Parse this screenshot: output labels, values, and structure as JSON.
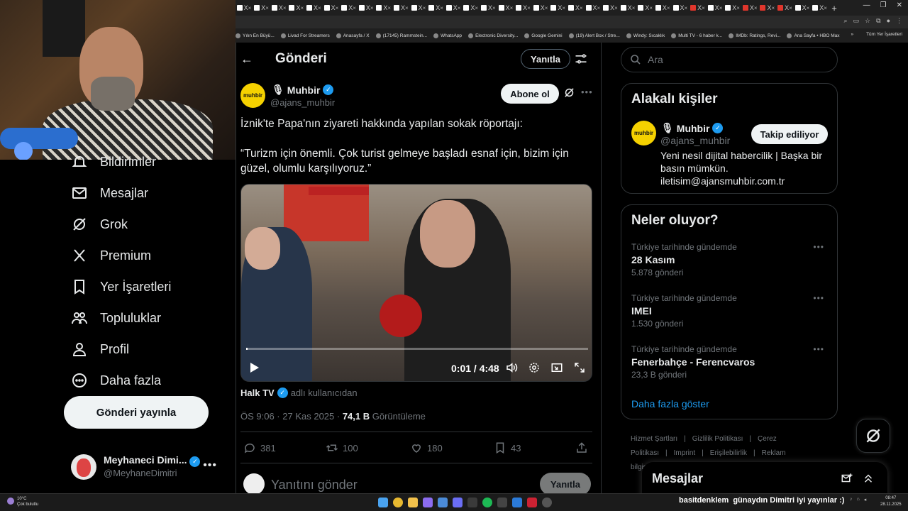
{
  "browser": {
    "tab_labels": [
      "X",
      "X",
      "X",
      "X",
      "X",
      "X",
      "X",
      "X",
      "X",
      "X",
      "X",
      "X",
      "X",
      "X",
      "X",
      "X",
      "X",
      "X",
      "X",
      "X",
      "X",
      "X",
      "X",
      "X",
      "X",
      "X",
      "X",
      "X",
      "X",
      "X",
      "X",
      "X",
      "X",
      "X"
    ],
    "tab_close": "×",
    "new_tab": "+",
    "bookmarks": [
      "Yılın En Büyü...",
      "Livad For Streamers",
      "Anasayfa / X",
      "(17145) Rammstein...",
      "WhatsApp",
      "Electronic Diversity...",
      "Google Gemini",
      "(19) Alert Box / Stre...",
      "Windy: Sıcaklık",
      "Multi TV - 6 haber k...",
      "IMDb: Ratings, Revi...",
      "Ana Sayfa • HBO Max"
    ],
    "bookmarks_more": "»",
    "all_bookmarks": "Tüm Yer İşaretleri"
  },
  "nav": {
    "items": [
      {
        "label": "Bildirimler",
        "icon": "bell-icon"
      },
      {
        "label": "Mesajlar",
        "icon": "envelope-icon"
      },
      {
        "label": "Grok",
        "icon": "grok-icon"
      },
      {
        "label": "Premium",
        "icon": "x-logo-icon"
      },
      {
        "label": "Yer İşaretleri",
        "icon": "bookmark-icon"
      },
      {
        "label": "Topluluklar",
        "icon": "people-icon"
      },
      {
        "label": "Profil",
        "icon": "person-icon"
      },
      {
        "label": "Daha fazla",
        "icon": "more-circle-icon"
      }
    ],
    "post_button": "Gönderi yayınla",
    "account": {
      "name": "Meyhaneci Dimi...",
      "handle": "@MeyhaneDimitri",
      "more": "•••"
    }
  },
  "header": {
    "back": "←",
    "title": "Gönderi",
    "reply_button": "Yanıtla"
  },
  "tweet": {
    "author_name": "Muhbir",
    "author_handle": "@ajans_muhbir",
    "avatar_text": "muhbir",
    "subscribe_button": "Abone ol",
    "more": "•••",
    "text_line1": "İznik'te Papa'nın ziyareti hakkında yapılan sokak röportajı:",
    "text_line2": "“Turizm için önemli. Çok turist gelmeye başladı esnaf için, bizim için güzel, olumlu karşılıyoruz.”",
    "video": {
      "time": "0:01 / 4:48",
      "progress": 0.004
    },
    "source_name": "Halk TV",
    "source_suffix": "adlı kullanıcıdan",
    "time": "ÖS 9:06 · 27 Kas 2025 · ",
    "views": "74,1 B",
    "views_label": " Görüntüleme",
    "stats": {
      "replies": "381",
      "reposts": "100",
      "likes": "180",
      "bookmarks": "43"
    },
    "reply_placeholder": "Yanıtını gönder",
    "reply_button": "Yanıtla"
  },
  "sidebar": {
    "search_placeholder": "Ara",
    "related": {
      "heading": "Alakalı kişiler",
      "name": "Muhbir",
      "handle": "@ajans_muhbir",
      "follow_button": "Takip ediliyor",
      "bio": "Yeni nesil dijital habercilik | Başka bir basın mümkün. iletisim@ajansmuhbir.com.tr"
    },
    "trends": {
      "heading": "Neler oluyor?",
      "items": [
        {
          "context": "Türkiye tarihinde gündemde",
          "title": "28 Kasım",
          "count": "5.878 gönderi"
        },
        {
          "context": "Türkiye tarihinde gündemde",
          "title": "IMEI",
          "count": "1.530 gönderi"
        },
        {
          "context": "Türkiye tarihinde gündemde",
          "title": "Fenerbahçe - Ferencvaros",
          "count": "23,3 B gönderi"
        }
      ],
      "show_more": "Daha fazla göster",
      "dots": "•••"
    },
    "footer": [
      "Hizmet Şartları",
      "|",
      "Gizlilik Politikası",
      "|",
      "Çerez Politikası",
      "|",
      "Imprint",
      "|",
      "Erişilebilirlik",
      "|",
      "Reklam bilgisi",
      "|",
      "Daha fazla •••",
      "© 20"
    ]
  },
  "messages_dock": {
    "title": "Mesajlar"
  },
  "taskbar": {
    "weather_temp": "10°C",
    "weather_desc": "Çok bulutlu",
    "ticker_user": "basitdenklem",
    "ticker_message": "günaydın Dimitri iyi yayınlar :)",
    "clock_time": "08:47",
    "clock_date": "28.11.2025"
  },
  "colors": {
    "accent": "#1d9bf0",
    "background": "#000000",
    "muted": "#71767b",
    "border": "#2f3336",
    "avatar_yellow": "#f5d100"
  }
}
